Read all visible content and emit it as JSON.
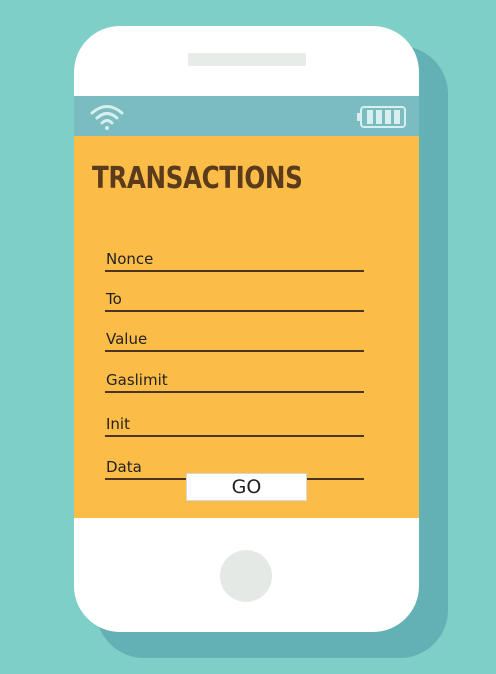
{
  "screen": {
    "title": "TRANSACTIONS",
    "fields": [
      {
        "label": "Nonce"
      },
      {
        "label": "To"
      },
      {
        "label": "Value"
      },
      {
        "label": "Gaslimit"
      },
      {
        "label": "Init"
      },
      {
        "label": "Data"
      }
    ],
    "go_button_label": "GO"
  },
  "icons": {
    "wifi": "wifi-icon",
    "battery": "battery-icon",
    "home": "home-button"
  },
  "colors": {
    "background": "#7ecfc8",
    "screen": "#fcbc48",
    "status_bar": "#7abcbf",
    "title": "#5a3b1b"
  }
}
